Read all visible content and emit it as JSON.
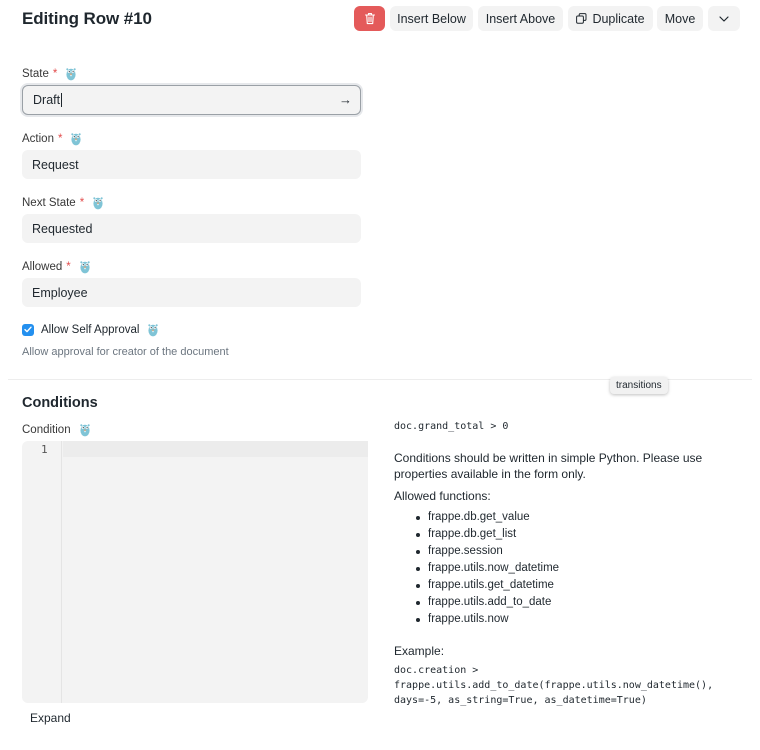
{
  "header": {
    "title": "Editing Row #10",
    "buttons": {
      "insert_below": "Insert Below",
      "insert_above": "Insert Above",
      "duplicate": "Duplicate",
      "move": "Move"
    },
    "delete_color": "#e45a5a"
  },
  "form": {
    "state": {
      "label": "State",
      "required": "*",
      "value": "Draft"
    },
    "action": {
      "label": "Action",
      "required": "*",
      "value": "Request"
    },
    "next_state": {
      "label": "Next State",
      "required": "*",
      "value": "Requested"
    },
    "allowed": {
      "label": "Allowed",
      "required": "*",
      "value": "Employee"
    },
    "allow_self_approval": {
      "label": "Allow Self Approval",
      "checked": true,
      "help": "Allow approval for creator of the document"
    }
  },
  "tooltip": "transitions",
  "conditions": {
    "section_title": "Conditions",
    "label": "Condition",
    "line_number": "1",
    "expand_label": "Expand"
  },
  "help_panel": {
    "example_inline": "doc.grand_total > 0",
    "description": "Conditions should be written in simple Python. Please use properties available in the form only.",
    "allowed_title": "Allowed functions:",
    "functions": [
      "frappe.db.get_value",
      "frappe.db.get_list",
      "frappe.session",
      "frappe.utils.now_datetime",
      "frappe.utils.get_datetime",
      "frappe.utils.add_to_date",
      "frappe.utils.now"
    ],
    "example_title": "Example:",
    "example_code": "doc.creation >\nfrappe.utils.add_to_date(frappe.utils.now_datetime(),\ndays=-5, as_string=True, as_datetime=True)"
  },
  "colors": {
    "accent": "#2490ef",
    "required": "#e24c4c",
    "field_bg": "#f3f3f3"
  }
}
